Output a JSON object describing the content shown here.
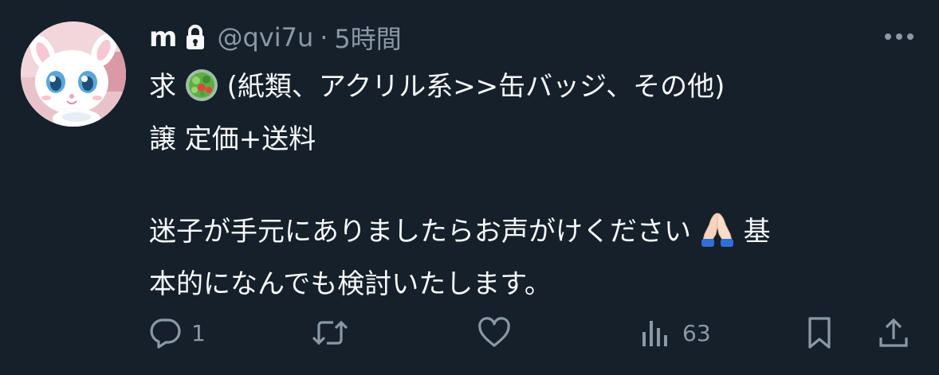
{
  "tweet": {
    "author": {
      "display_name": "m",
      "handle": "@qvi7u",
      "separator": "·",
      "time": "5時間",
      "avatar": "avatar-white-cat",
      "protected_icon": "lock-icon"
    },
    "more_icon": "more-dots-icon",
    "text": {
      "line1_prefix": "求",
      "line1_emoji": "salad-emoji",
      "line1_rest": "(紙類、アクリル系>>缶バッジ、その他)",
      "line2": "譲 定価+送料",
      "line3_main": "迷子が手元にありましたらお声がけください",
      "line3_emoji": "folded-hands-emoji",
      "line3_tail": "基",
      "line4": "本的になんでも検討いたします。"
    },
    "actions": {
      "reply": {
        "icon": "reply-icon",
        "count": "1"
      },
      "retweet": {
        "icon": "retweet-icon",
        "count": ""
      },
      "like": {
        "icon": "heart-icon",
        "count": ""
      },
      "views": {
        "icon": "views-icon",
        "count": "63"
      },
      "bookmark": {
        "icon": "bookmark-icon"
      },
      "share": {
        "icon": "share-icon"
      }
    },
    "colors": {
      "background": "#15202b",
      "primary_text": "#f7f9f9",
      "secondary_text": "#8b98a5"
    }
  }
}
